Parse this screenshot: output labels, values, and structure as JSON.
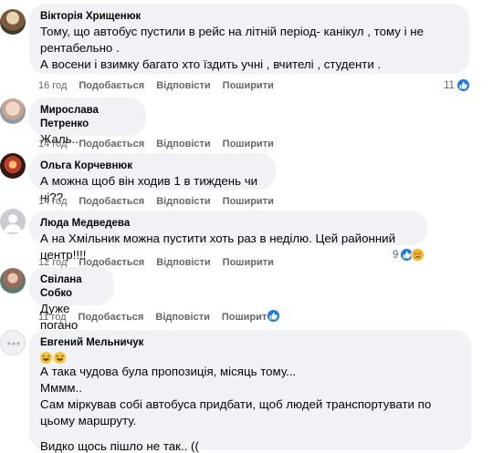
{
  "comments": [
    {
      "author": "Вікторія Хрищенюк",
      "text": "Тому, що автобус пустили в рейс на літній період- канікул , тому і не рентабельно .\nА восени і взимку багато хто їздить учні , вчителі , студенти .",
      "time": "16 год",
      "like": "Подобається",
      "reply": "Відповісти",
      "share": "Поширити",
      "reactions": "11"
    },
    {
      "author": "Мирослава Петренко",
      "text": "Жаль...",
      "time": "14 год",
      "like": "Подобається",
      "reply": "Відповісти",
      "share": "Поширити"
    },
    {
      "author": "Ольга Корчевнюк",
      "text": "А можна щоб він ходив 1 в тиждень чи ні??",
      "time": "14 год",
      "like": "Подобається",
      "reply": "Відповісти",
      "share": "Поширити"
    },
    {
      "author": "Люда Медведева",
      "text": "А на Хмільник можна пустити хоть раз в неділю. Цей районний центр!!!!",
      "time": "12 год",
      "like": "Подобається",
      "reply": "Відповісти",
      "share": "Поширити",
      "reactions": "9"
    },
    {
      "author": "Свілана Собко",
      "text": "Дуже погано",
      "time": "11 год",
      "like": "Подобається",
      "reply": "Відповісти",
      "share": "Поширити"
    },
    {
      "author": "Евгений Мельничук",
      "text_lines": [
        "А така чудова була пропозиція, місяць тому...",
        "Мммм..",
        "Сам міркував собі автобуса придбати, щоб людей транспортувати по цьому маршруту.",
        "Видко щось пішло не так.. (("
      ]
    }
  ],
  "colors": {
    "bubble": "#f0f2f5",
    "meta": "#65676b",
    "like_blue": "#1877f2",
    "sad_yellow": "#f7b125"
  }
}
